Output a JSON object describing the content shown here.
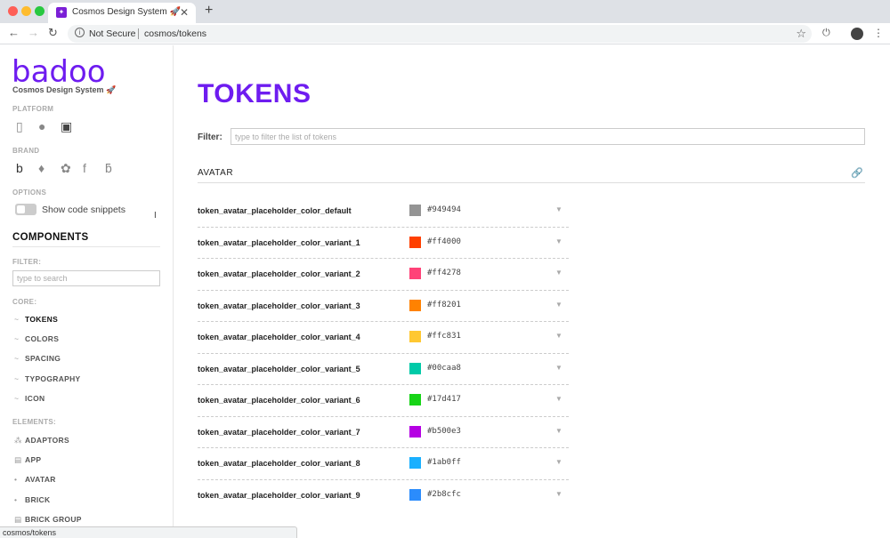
{
  "browser": {
    "tab_title": "Cosmos Design System 🚀",
    "tab_favicon": "badoo-favicon",
    "close_glyph": "✕",
    "newtab_glyph": "+",
    "security": "Not Secure",
    "url": "cosmos/tokens",
    "status_url": "cosmos/tokens"
  },
  "sidebar": {
    "logo": "badoo",
    "subtitle": "Cosmos Design System 🚀",
    "platform_label": "PLATFORM",
    "brand_label": "BRAND",
    "options_label": "OPTIONS",
    "show_snippets_label": "Show code snippets",
    "components_title": "COMPONENTS",
    "filter_label": "FILTER:",
    "search_placeholder": "type to search",
    "core_label": "CORE:",
    "core_items": [
      {
        "label": "TOKENS",
        "bullet": "~",
        "active": true
      },
      {
        "label": "COLORS",
        "bullet": "~",
        "active": false
      },
      {
        "label": "SPACING",
        "bullet": "~",
        "active": false
      },
      {
        "label": "TYPOGRAPHY",
        "bullet": "~",
        "active": false
      },
      {
        "label": "ICON",
        "bullet": "~",
        "active": false
      }
    ],
    "elements_label": "ELEMENTS:",
    "element_items": [
      {
        "label": "ADAPTORS",
        "bullet": "⁂"
      },
      {
        "label": "APP",
        "bullet": "▤"
      },
      {
        "label": "AVATAR",
        "bullet": "•"
      },
      {
        "label": "BRICK",
        "bullet": "•"
      },
      {
        "label": "BRICK GROUP",
        "bullet": "▤"
      }
    ]
  },
  "main": {
    "title": "TOKENS",
    "filter_label": "Filter:",
    "filter_placeholder": "type to filter the list of tokens",
    "section_title": "AVATAR",
    "tokens": [
      {
        "name": "token_avatar_placeholder_color_default",
        "hex": "#949494",
        "color": "#949494"
      },
      {
        "name": "token_avatar_placeholder_color_variant_1",
        "hex": "#ff4000",
        "color": "#ff4000"
      },
      {
        "name": "token_avatar_placeholder_color_variant_2",
        "hex": "#ff4278",
        "color": "#ff4278"
      },
      {
        "name": "token_avatar_placeholder_color_variant_3",
        "hex": "#ff8201",
        "color": "#ff8201"
      },
      {
        "name": "token_avatar_placeholder_color_variant_4",
        "hex": "#ffc831",
        "color": "#ffc831"
      },
      {
        "name": "token_avatar_placeholder_color_variant_5",
        "hex": "#00caa8",
        "color": "#00caa8"
      },
      {
        "name": "token_avatar_placeholder_color_variant_6",
        "hex": "#17d417",
        "color": "#17d417"
      },
      {
        "name": "token_avatar_placeholder_color_variant_7",
        "hex": "#b500e3",
        "color": "#b500e3"
      },
      {
        "name": "token_avatar_placeholder_color_variant_8",
        "hex": "#1ab0ff",
        "color": "#1ab0ff"
      },
      {
        "name": "token_avatar_placeholder_color_variant_9",
        "hex": "#2b8cfc",
        "color": "#2b8cfc"
      }
    ]
  },
  "colors": {
    "accent": "#6e1cf0"
  }
}
